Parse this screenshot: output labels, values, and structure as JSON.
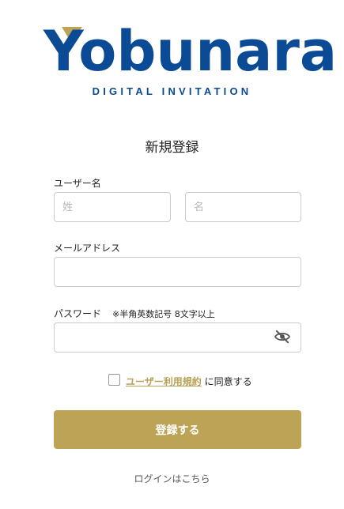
{
  "brand": {
    "logo_text": "Yobunara",
    "tagline": "DIGITAL INVITATION",
    "primary_color": "#0b4a94",
    "accent_color": "#bda356"
  },
  "page": {
    "title": "新規登録"
  },
  "form": {
    "username_label": "ユーザー名",
    "last_name_placeholder": "姓",
    "first_name_placeholder": "名",
    "email_label": "メールアドレス",
    "email_value": "",
    "password_label": "パスワード",
    "password_note": "※半角英数記号 8文字以上",
    "password_value": "",
    "password_toggle_icon": "eye-off-icon",
    "agree_checked": false,
    "terms_link_text": "ユーザー利用規約",
    "agree_suffix": "に同意する",
    "submit_label": "登録する"
  },
  "footer": {
    "login_link": "ログインはこちら"
  }
}
